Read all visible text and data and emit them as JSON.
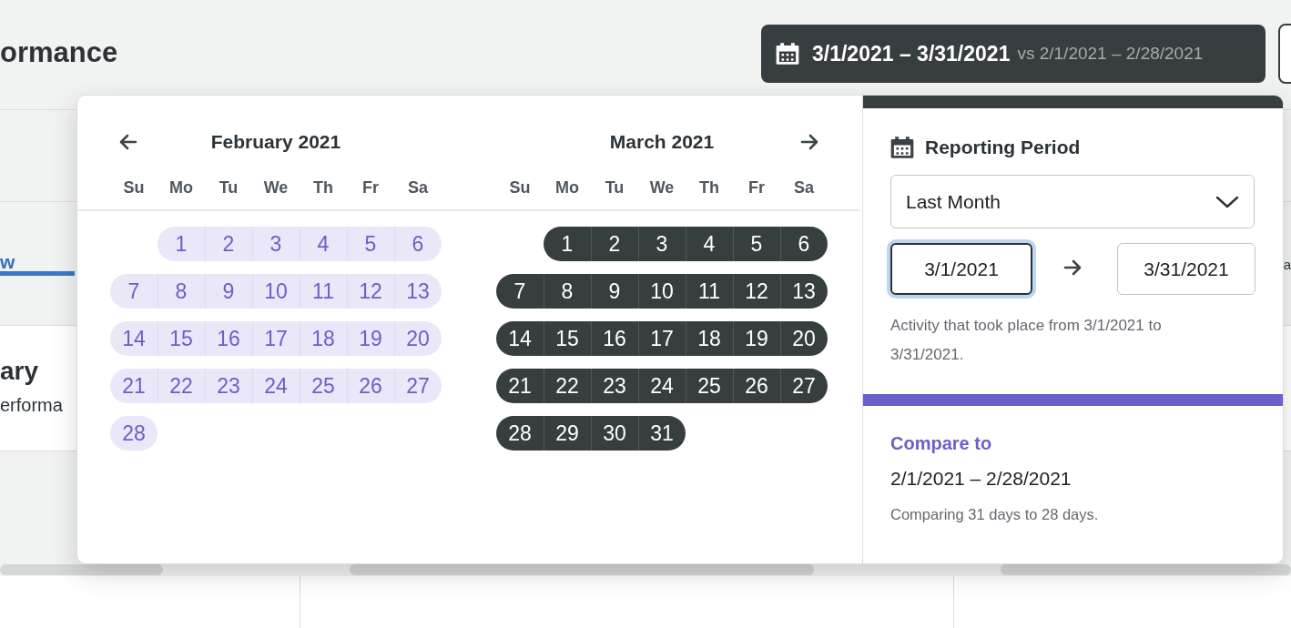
{
  "page": {
    "title": "ormance",
    "date_button": {
      "range": "3/1/2021 – 3/31/2021",
      "compare": "vs 2/1/2021 – 2/28/2021"
    },
    "tab": {
      "label": "w",
      "selected": true
    },
    "side_tab": "a",
    "card": {
      "title": "ary",
      "subtitle": "erforma"
    }
  },
  "picker": {
    "months": [
      {
        "title": "February 2021",
        "kind": "compare",
        "weekdays": [
          "Su",
          "Mo",
          "Tu",
          "We",
          "Th",
          "Fr",
          "Sa"
        ],
        "weeks": [
          {
            "kind": "first",
            "days": [
              "1",
              "2",
              "3",
              "4",
              "5",
              "6"
            ]
          },
          {
            "kind": "full",
            "days": [
              "7",
              "8",
              "9",
              "10",
              "11",
              "12",
              "13"
            ]
          },
          {
            "kind": "full",
            "days": [
              "14",
              "15",
              "16",
              "17",
              "18",
              "19",
              "20"
            ]
          },
          {
            "kind": "full",
            "days": [
              "21",
              "22",
              "23",
              "24",
              "25",
              "26",
              "27"
            ]
          },
          {
            "kind": "last",
            "days": [
              "28"
            ]
          }
        ]
      },
      {
        "title": "March 2021",
        "kind": "primary",
        "weekdays": [
          "Su",
          "Mo",
          "Tu",
          "We",
          "Th",
          "Fr",
          "Sa"
        ],
        "weeks": [
          {
            "kind": "first",
            "days": [
              "1",
              "2",
              "3",
              "4",
              "5",
              "6"
            ]
          },
          {
            "kind": "full",
            "days": [
              "7",
              "8",
              "9",
              "10",
              "11",
              "12",
              "13"
            ]
          },
          {
            "kind": "full",
            "days": [
              "14",
              "15",
              "16",
              "17",
              "18",
              "19",
              "20"
            ]
          },
          {
            "kind": "full",
            "days": [
              "21",
              "22",
              "23",
              "24",
              "25",
              "26",
              "27"
            ]
          },
          {
            "kind": "last",
            "days": [
              "28",
              "29",
              "30",
              "31"
            ]
          }
        ]
      }
    ],
    "panel": {
      "heading": "Reporting Period",
      "preset": "Last Month",
      "start": {
        "value": "3/1/2021",
        "focused": true
      },
      "end": {
        "value": "3/31/2021",
        "focused": false
      },
      "note": "Activity that took place from 3/1/2021 to 3/31/2021.",
      "compare_heading": "Compare to",
      "compare_range": "2/1/2021 – 2/28/2021",
      "compare_note": "Comparing 31 days to 28 days."
    }
  }
}
